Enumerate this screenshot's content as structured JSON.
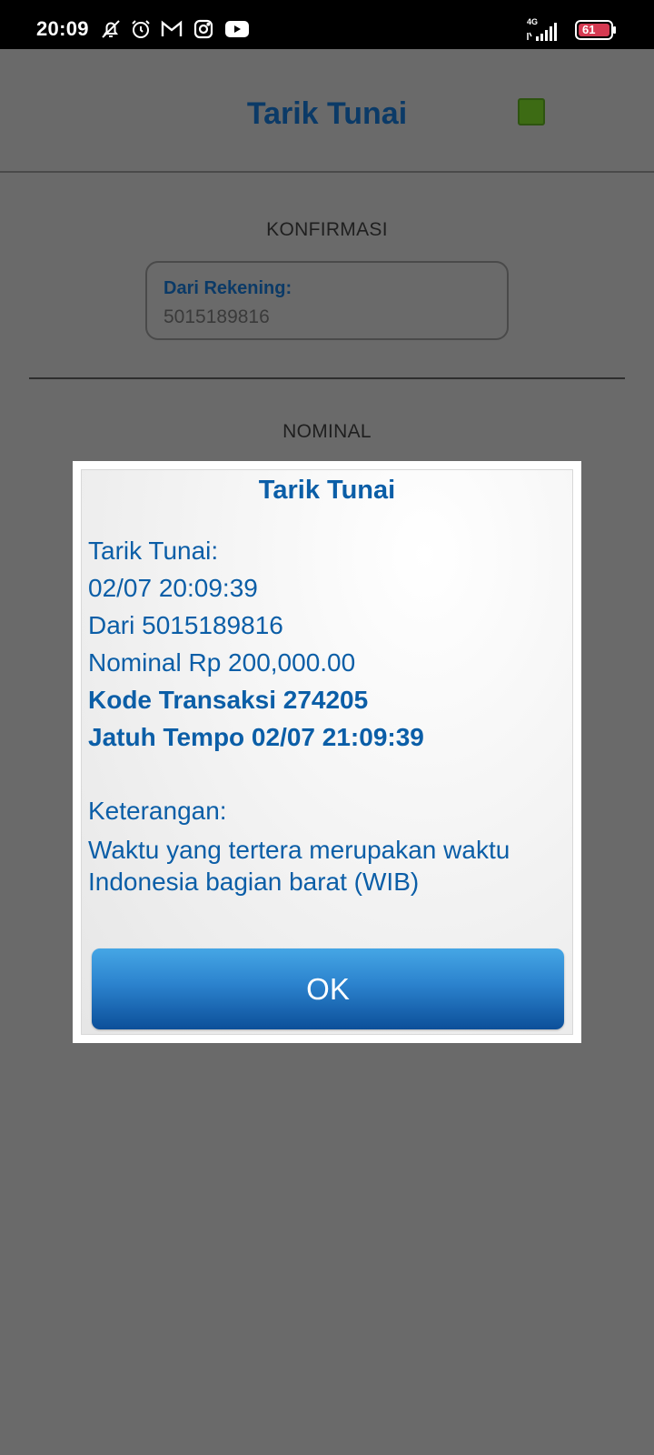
{
  "status_bar": {
    "time": "20:09",
    "network": "4G",
    "battery": "61",
    "icons": [
      "notifications-off-icon",
      "alarm-icon",
      "gmail-icon",
      "instagram-icon",
      "youtube-icon"
    ]
  },
  "header": {
    "title": "Tarik Tunai",
    "status_color": "#3d6b14"
  },
  "confirmation": {
    "section_label": "KONFIRMASI",
    "from_account_label": "Dari Rekening:",
    "from_account_value": "5015189816"
  },
  "nominal_section": {
    "label": "NOMINAL"
  },
  "dialog": {
    "title": "Tarik Tunai",
    "lines": [
      "Tarik Tunai:",
      "02/07 20:09:39",
      "Dari 5015189816",
      "Nominal Rp 200,000.00",
      "Kode Transaksi 274205",
      "Jatuh Tempo 02/07 21:09:39"
    ],
    "note_label": "Keterangan:",
    "note_text": "Waktu yang tertera merupakan waktu Indonesia bagian barat (WIB)",
    "ok_label": "OK"
  },
  "colors": {
    "accent": "#0b5ea7",
    "header_title": "#0b3a67",
    "overlay": "#6a6a6a"
  }
}
